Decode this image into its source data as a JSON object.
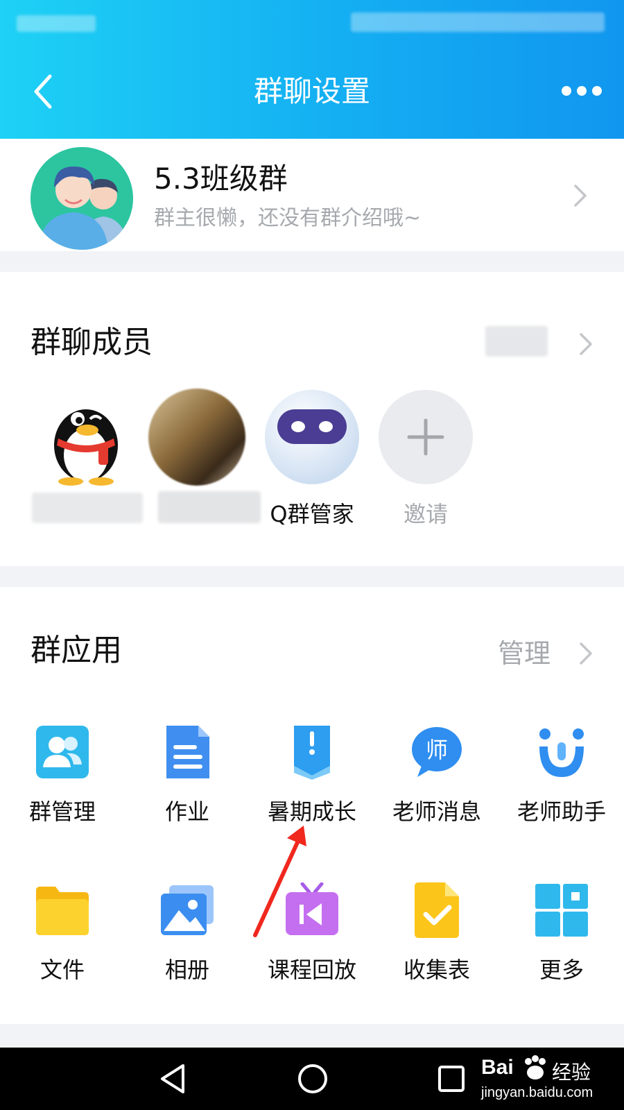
{
  "header": {
    "title": "群聊设置"
  },
  "group": {
    "name": "5.3班级群",
    "intro": "群主很懒，还没有群介绍哦~"
  },
  "members": {
    "section_title": "群聊成员",
    "items": [
      {
        "label": ""
      },
      {
        "label": ""
      },
      {
        "label": "Q群管家"
      },
      {
        "label": "邀请"
      }
    ]
  },
  "apps": {
    "section_title": "群应用",
    "manage_label": "管理",
    "row1": [
      {
        "label": "群管理",
        "icon": "group-manage-icon"
      },
      {
        "label": "作业",
        "icon": "homework-icon"
      },
      {
        "label": "暑期成长",
        "icon": "summer-growth-icon"
      },
      {
        "label": "老师消息",
        "icon": "teacher-message-icon"
      },
      {
        "label": "老师助手",
        "icon": "teacher-assistant-icon"
      }
    ],
    "row2": [
      {
        "label": "文件",
        "icon": "folder-icon"
      },
      {
        "label": "相册",
        "icon": "album-icon"
      },
      {
        "label": "课程回放",
        "icon": "course-replay-icon"
      },
      {
        "label": "收集表",
        "icon": "collection-form-icon"
      },
      {
        "label": "更多",
        "icon": "more-apps-icon"
      }
    ]
  },
  "watermark": {
    "brand": "Bai",
    "brand_suffix": "经验",
    "url": "jingyan.baidu.com"
  },
  "colors": {
    "header_start": "#1ed1f5",
    "header_end": "#1196ef",
    "arrow_annotation": "#f0281e"
  }
}
